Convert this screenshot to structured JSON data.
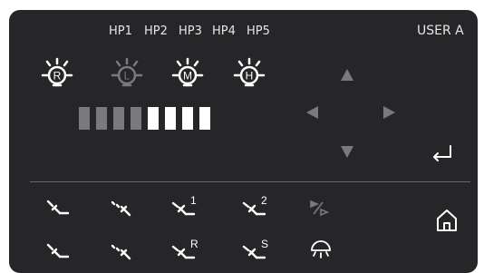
{
  "presets": [
    "HP1",
    "HP2",
    "HP3",
    "HP4",
    "HP5"
  ],
  "user_label": "USER A",
  "lamps": [
    {
      "letter": "R",
      "active": true
    },
    {
      "letter": "L",
      "active": false
    },
    {
      "letter": "M",
      "active": true
    },
    {
      "letter": "H",
      "active": true
    }
  ],
  "intensity": {
    "total": 8,
    "filled": 4
  },
  "nav": [
    "arrow-up",
    "arrow-left",
    "arrow-right",
    "arrow-down",
    "enter"
  ],
  "bottom_row1_labels": [
    "",
    "",
    "1",
    "2",
    ""
  ],
  "bottom_row2_labels": [
    "",
    "",
    "R",
    "S",
    ""
  ],
  "colors": {
    "panel": "#262629",
    "text": "#e6e6e6",
    "dim": "#7a7a7e",
    "bright": "#ffffff"
  }
}
